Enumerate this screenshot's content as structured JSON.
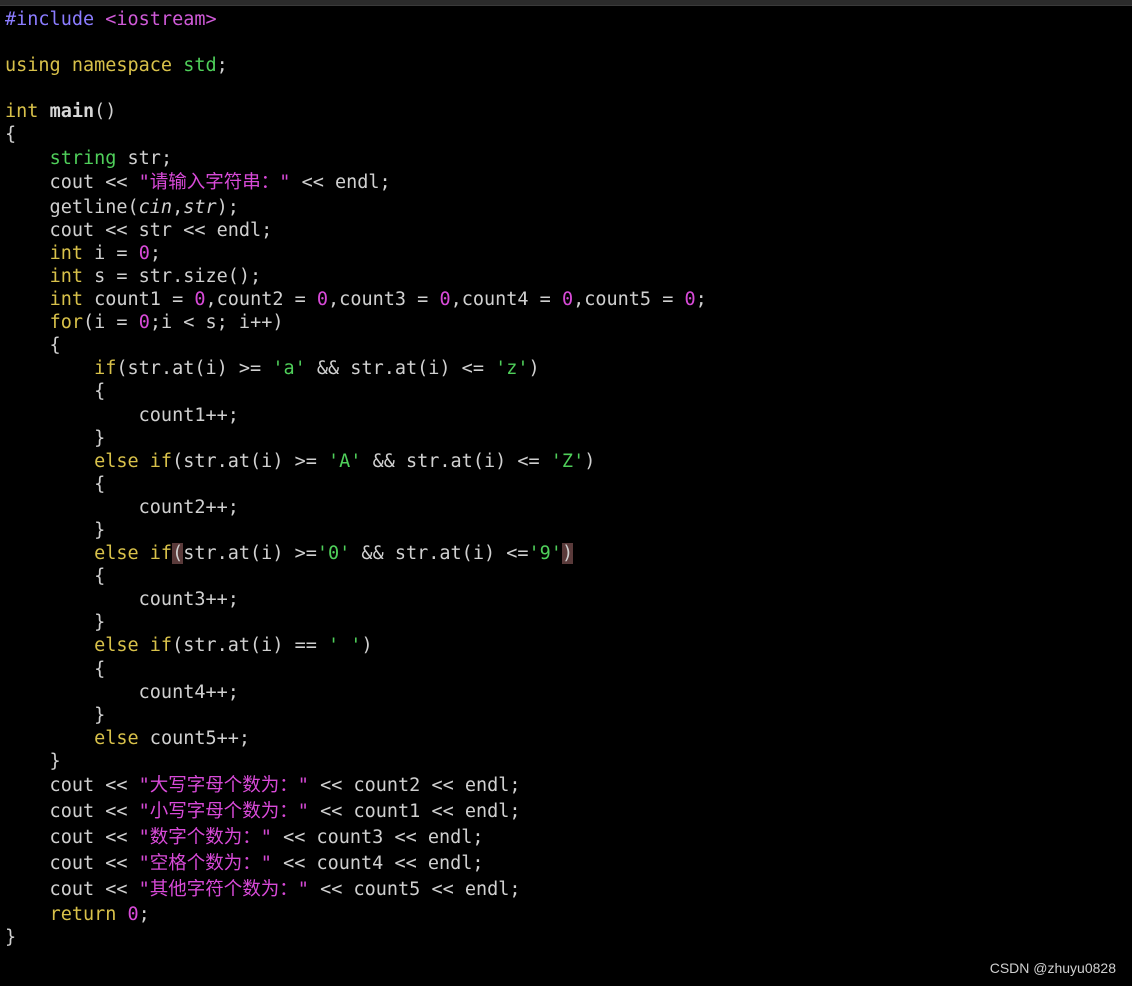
{
  "editor": {
    "lines": [
      {
        "tokens": [
          {
            "t": "#include ",
            "c": "preproc"
          },
          {
            "t": "<iostream>",
            "c": "header"
          }
        ]
      },
      {
        "tokens": []
      },
      {
        "tokens": [
          {
            "t": "using namespace ",
            "c": "kw"
          },
          {
            "t": "std",
            "c": "type"
          },
          {
            "t": ";",
            "c": ""
          }
        ]
      },
      {
        "tokens": []
      },
      {
        "tokens": [
          {
            "t": "int ",
            "c": "kw"
          },
          {
            "t": "main",
            "c": "fn"
          },
          {
            "t": "()",
            "c": ""
          }
        ]
      },
      {
        "tokens": [
          {
            "t": "{",
            "c": ""
          }
        ]
      },
      {
        "tokens": [
          {
            "t": "    ",
            "c": ""
          },
          {
            "t": "string",
            "c": "type"
          },
          {
            "t": " str;",
            "c": ""
          }
        ]
      },
      {
        "tall": true,
        "tokens": [
          {
            "t": "    cout << ",
            "c": ""
          },
          {
            "t": "\"请输入字符串：\"",
            "c": "str"
          },
          {
            "t": " << endl;",
            "c": ""
          }
        ]
      },
      {
        "tokens": [
          {
            "t": "    getline(",
            "c": ""
          },
          {
            "t": "cin",
            "c": "ital"
          },
          {
            "t": ",",
            "c": ""
          },
          {
            "t": "str",
            "c": "ital"
          },
          {
            "t": ");",
            "c": ""
          }
        ]
      },
      {
        "tokens": [
          {
            "t": "    cout << str << endl;",
            "c": ""
          }
        ]
      },
      {
        "tokens": [
          {
            "t": "    ",
            "c": ""
          },
          {
            "t": "int",
            "c": "kw"
          },
          {
            "t": " i = ",
            "c": ""
          },
          {
            "t": "0",
            "c": "num"
          },
          {
            "t": ";",
            "c": ""
          }
        ]
      },
      {
        "tokens": [
          {
            "t": "    ",
            "c": ""
          },
          {
            "t": "int",
            "c": "kw"
          },
          {
            "t": " s = str.size();",
            "c": ""
          }
        ]
      },
      {
        "tokens": [
          {
            "t": "    ",
            "c": ""
          },
          {
            "t": "int",
            "c": "kw"
          },
          {
            "t": " count1 = ",
            "c": ""
          },
          {
            "t": "0",
            "c": "num"
          },
          {
            "t": ",count2 = ",
            "c": ""
          },
          {
            "t": "0",
            "c": "num"
          },
          {
            "t": ",count3 = ",
            "c": ""
          },
          {
            "t": "0",
            "c": "num"
          },
          {
            "t": ",count4 = ",
            "c": ""
          },
          {
            "t": "0",
            "c": "num"
          },
          {
            "t": ",count5 = ",
            "c": ""
          },
          {
            "t": "0",
            "c": "num"
          },
          {
            "t": ";",
            "c": ""
          }
        ]
      },
      {
        "tokens": [
          {
            "t": "    ",
            "c": ""
          },
          {
            "t": "for",
            "c": "kw"
          },
          {
            "t": "(i = ",
            "c": ""
          },
          {
            "t": "0",
            "c": "num"
          },
          {
            "t": ";i < s; i++)",
            "c": ""
          }
        ]
      },
      {
        "tokens": [
          {
            "t": "    {",
            "c": ""
          }
        ]
      },
      {
        "tokens": [
          {
            "t": "        ",
            "c": ""
          },
          {
            "t": "if",
            "c": "kw"
          },
          {
            "t": "(str.at(i) >= ",
            "c": ""
          },
          {
            "t": "'a'",
            "c": "chr"
          },
          {
            "t": " && str.at(i) <= ",
            "c": ""
          },
          {
            "t": "'z'",
            "c": "chr"
          },
          {
            "t": ")",
            "c": ""
          }
        ]
      },
      {
        "tokens": [
          {
            "t": "        {",
            "c": ""
          }
        ]
      },
      {
        "tokens": [
          {
            "t": "            count1++;",
            "c": ""
          }
        ]
      },
      {
        "tokens": [
          {
            "t": "        }",
            "c": ""
          }
        ]
      },
      {
        "tokens": [
          {
            "t": "        ",
            "c": ""
          },
          {
            "t": "else if",
            "c": "kw"
          },
          {
            "t": "(str.at(i) >= ",
            "c": ""
          },
          {
            "t": "'A'",
            "c": "chr"
          },
          {
            "t": " && str.at(i) <= ",
            "c": ""
          },
          {
            "t": "'Z'",
            "c": "chr"
          },
          {
            "t": ")",
            "c": ""
          }
        ]
      },
      {
        "tokens": [
          {
            "t": "        {",
            "c": ""
          }
        ]
      },
      {
        "tokens": [
          {
            "t": "            count2++;",
            "c": ""
          }
        ]
      },
      {
        "tokens": [
          {
            "t": "        }",
            "c": ""
          }
        ]
      },
      {
        "tokens": [
          {
            "t": "        ",
            "c": ""
          },
          {
            "t": "else if",
            "c": "kw"
          },
          {
            "t": "(",
            "c": "match"
          },
          {
            "t": "str.at(i) >=",
            "c": ""
          },
          {
            "t": "'0'",
            "c": "chr"
          },
          {
            "t": " && str.at(i) <=",
            "c": ""
          },
          {
            "t": "'9'",
            "c": "chr"
          },
          {
            "t": ")",
            "c": "match"
          }
        ]
      },
      {
        "tokens": [
          {
            "t": "        {",
            "c": ""
          }
        ]
      },
      {
        "tokens": [
          {
            "t": "            count3++;",
            "c": ""
          }
        ]
      },
      {
        "tokens": [
          {
            "t": "        }",
            "c": ""
          }
        ]
      },
      {
        "tokens": [
          {
            "t": "        ",
            "c": ""
          },
          {
            "t": "else if",
            "c": "kw"
          },
          {
            "t": "(str.at(i) == ",
            "c": ""
          },
          {
            "t": "' '",
            "c": "chr"
          },
          {
            "t": ")",
            "c": ""
          }
        ]
      },
      {
        "tokens": [
          {
            "t": "        {",
            "c": ""
          }
        ]
      },
      {
        "tokens": [
          {
            "t": "            count4++;",
            "c": ""
          }
        ]
      },
      {
        "tokens": [
          {
            "t": "        }",
            "c": ""
          }
        ]
      },
      {
        "tokens": [
          {
            "t": "        ",
            "c": ""
          },
          {
            "t": "else",
            "c": "kw"
          },
          {
            "t": " count5++;",
            "c": ""
          }
        ]
      },
      {
        "tokens": [
          {
            "t": "    }",
            "c": ""
          }
        ]
      },
      {
        "tall": true,
        "tokens": [
          {
            "t": "    cout << ",
            "c": ""
          },
          {
            "t": "\"大写字母个数为：\"",
            "c": "str"
          },
          {
            "t": " << count2 << endl;",
            "c": ""
          }
        ]
      },
      {
        "tall": true,
        "tokens": [
          {
            "t": "    cout << ",
            "c": ""
          },
          {
            "t": "\"小写字母个数为：\"",
            "c": "str"
          },
          {
            "t": " << count1 << endl;",
            "c": ""
          }
        ]
      },
      {
        "tall": true,
        "tokens": [
          {
            "t": "    cout << ",
            "c": ""
          },
          {
            "t": "\"数字个数为：\"",
            "c": "str"
          },
          {
            "t": " << count3 << endl;",
            "c": ""
          }
        ]
      },
      {
        "tall": true,
        "tokens": [
          {
            "t": "    cout << ",
            "c": ""
          },
          {
            "t": "\"空格个数为：\"",
            "c": "str"
          },
          {
            "t": " << count4 << endl;",
            "c": ""
          }
        ]
      },
      {
        "tall": true,
        "tokens": [
          {
            "t": "    cout << ",
            "c": ""
          },
          {
            "t": "\"其他字符个数为：\"",
            "c": "str"
          },
          {
            "t": " << count5 << endl;",
            "c": ""
          }
        ]
      },
      {
        "tokens": [
          {
            "t": "    ",
            "c": ""
          },
          {
            "t": "return",
            "c": "kw"
          },
          {
            "t": " ",
            "c": ""
          },
          {
            "t": "0",
            "c": "num"
          },
          {
            "t": ";",
            "c": ""
          }
        ]
      },
      {
        "tokens": [
          {
            "t": "}",
            "c": ""
          }
        ]
      }
    ]
  },
  "watermark": {
    "text": "CSDN @zhuyu0828"
  }
}
